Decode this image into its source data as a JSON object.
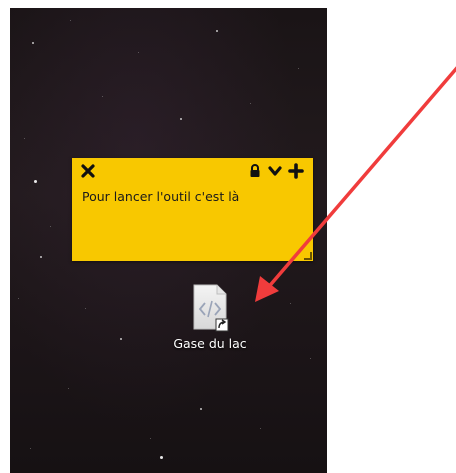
{
  "note": {
    "text": "Pour lancer l'outil c'est là",
    "background_color": "#f8c800",
    "toolbar": {
      "close_icon": "close-icon",
      "lock_icon": "lock-icon",
      "collapse_icon": "chevron-down-icon",
      "add_icon": "plus-icon"
    }
  },
  "desktop_icon": {
    "label": "Gase du lac",
    "icon": "html-file-link-icon"
  },
  "annotation": {
    "color": "#f03c3c",
    "icon": "red-arrow"
  }
}
